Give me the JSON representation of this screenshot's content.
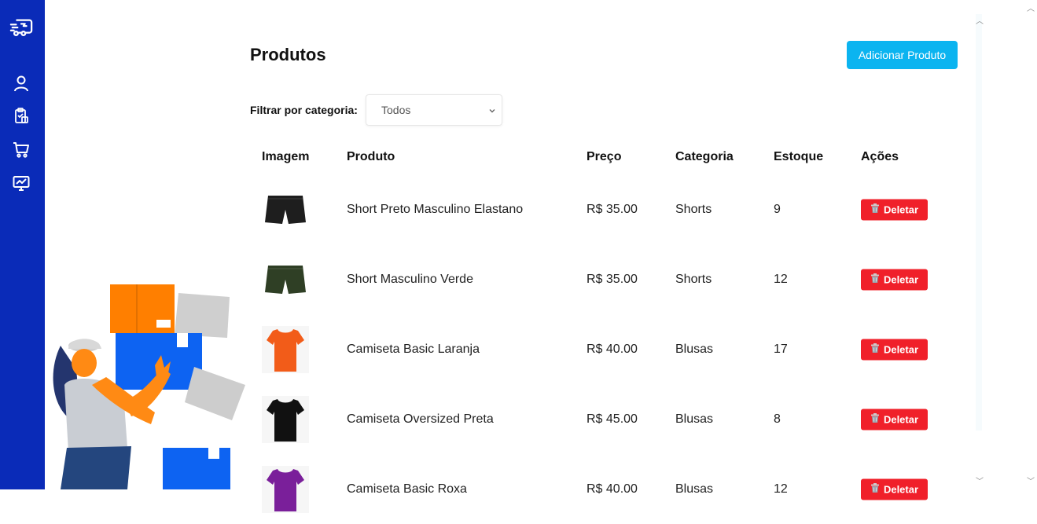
{
  "sidebar": {
    "items": [
      {
        "icon": "logo-truck-icon"
      },
      {
        "icon": "user-icon"
      },
      {
        "icon": "clipboard-icon"
      },
      {
        "icon": "cart-icon"
      },
      {
        "icon": "dashboard-chart-icon"
      }
    ]
  },
  "page": {
    "title": "Produtos",
    "add_button_label": "Adicionar Produto"
  },
  "filter": {
    "label": "Filtrar por categoria:",
    "selected": "Todos"
  },
  "table": {
    "headers": {
      "image": "Imagem",
      "product": "Produto",
      "price": "Preço",
      "category": "Categoria",
      "stock": "Estoque",
      "actions": "Ações"
    },
    "delete_label": "Deletar",
    "rows": [
      {
        "name": "Short Preto Masculino Elastano",
        "price": "R$ 35.00",
        "category": "Shorts",
        "stock": "9",
        "color": "#1e1e1e",
        "kind": "short"
      },
      {
        "name": "Short Masculino Verde",
        "price": "R$ 35.00",
        "category": "Shorts",
        "stock": "12",
        "color": "#2f3f25",
        "kind": "short"
      },
      {
        "name": "Camiseta Basic Laranja",
        "price": "R$ 40.00",
        "category": "Blusas",
        "stock": "17",
        "color": "#f25c19",
        "kind": "shirt"
      },
      {
        "name": "Camiseta Oversized Preta",
        "price": "R$ 45.00",
        "category": "Blusas",
        "stock": "8",
        "color": "#111111",
        "kind": "shirt"
      },
      {
        "name": "Camiseta Basic Roxa",
        "price": "R$ 40.00",
        "category": "Blusas",
        "stock": "12",
        "color": "#7a1f9a",
        "kind": "shirt"
      }
    ]
  },
  "colors": {
    "sidebar": "#0a2bb8",
    "primary_button": "#0bb4f0",
    "delete_button": "#f0202a"
  }
}
